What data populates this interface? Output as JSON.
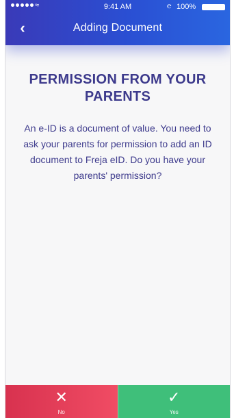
{
  "status_bar": {
    "wifi_icon": "wifi-icon",
    "time": "9:41 AM",
    "bluetooth_icon": "bluetooth-icon",
    "battery_percent": "100%"
  },
  "header": {
    "back_icon": "back-chevron-icon",
    "title": "Adding Document"
  },
  "content": {
    "heading": "PERMISSION FROM YOUR PARENTS",
    "body": "An e-ID is a document of value. You need to ask your parents for permission to add an ID document to Freja eID. Do you have your parents' permission?"
  },
  "footer": {
    "no": {
      "icon": "close-icon",
      "label": "No"
    },
    "yes": {
      "icon": "check-icon",
      "label": "Yes"
    }
  },
  "colors": {
    "header_start": "#3a3ab8",
    "header_end": "#2a66e0",
    "text": "#3d3a8c",
    "no_button": "#e03c58",
    "yes_button": "#3fbf7a"
  }
}
